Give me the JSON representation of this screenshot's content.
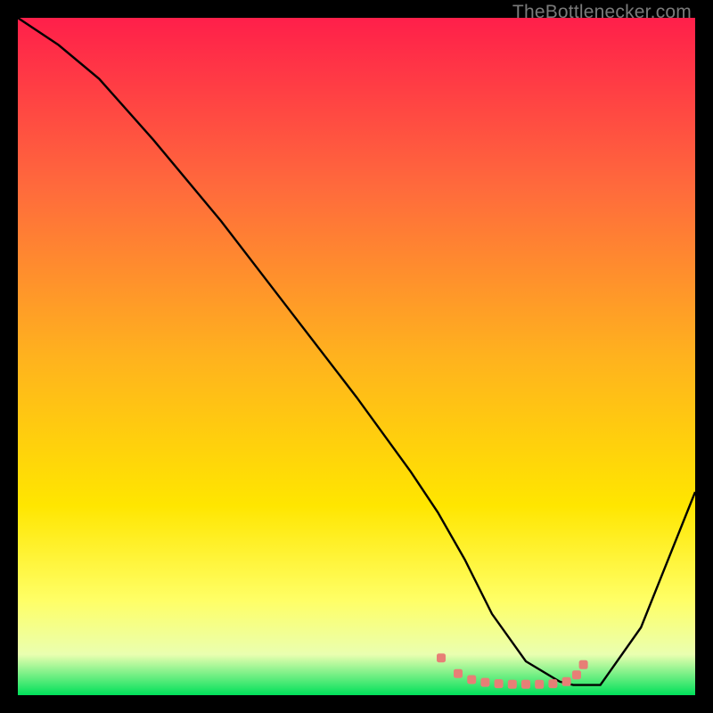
{
  "watermark": "TheBottlenecker.com",
  "chart_data": {
    "type": "line",
    "title": "",
    "xlabel": "",
    "ylabel": "",
    "xlim": [
      0,
      100
    ],
    "ylim": [
      0,
      100
    ],
    "grid": false,
    "gradient": {
      "stops": [
        {
          "offset": 0,
          "color": "#ff1f4a"
        },
        {
          "offset": 25,
          "color": "#ff6a3c"
        },
        {
          "offset": 50,
          "color": "#ffb21e"
        },
        {
          "offset": 72,
          "color": "#ffe600"
        },
        {
          "offset": 86,
          "color": "#ffff66"
        },
        {
          "offset": 94,
          "color": "#eaffb0"
        },
        {
          "offset": 100,
          "color": "#00e05a"
        }
      ]
    },
    "series": [
      {
        "name": "bottleneck-curve",
        "color": "#000000",
        "x": [
          0,
          6,
          12,
          20,
          30,
          40,
          50,
          58,
          62,
          66,
          70,
          75,
          80,
          82,
          86,
          92,
          100
        ],
        "y": [
          100,
          96,
          91,
          82,
          70,
          57,
          44,
          33,
          27,
          20,
          12,
          5,
          2,
          1.5,
          1.5,
          10,
          30
        ]
      }
    ],
    "markers": {
      "name": "optimal-zone",
      "color": "#e77f76",
      "x": [
        62.5,
        65,
        67,
        69,
        71,
        73,
        75,
        77,
        79,
        81,
        82.5,
        83.5
      ],
      "y": [
        5.5,
        3.2,
        2.3,
        1.9,
        1.7,
        1.6,
        1.6,
        1.6,
        1.7,
        2.0,
        3.0,
        4.5
      ]
    }
  }
}
